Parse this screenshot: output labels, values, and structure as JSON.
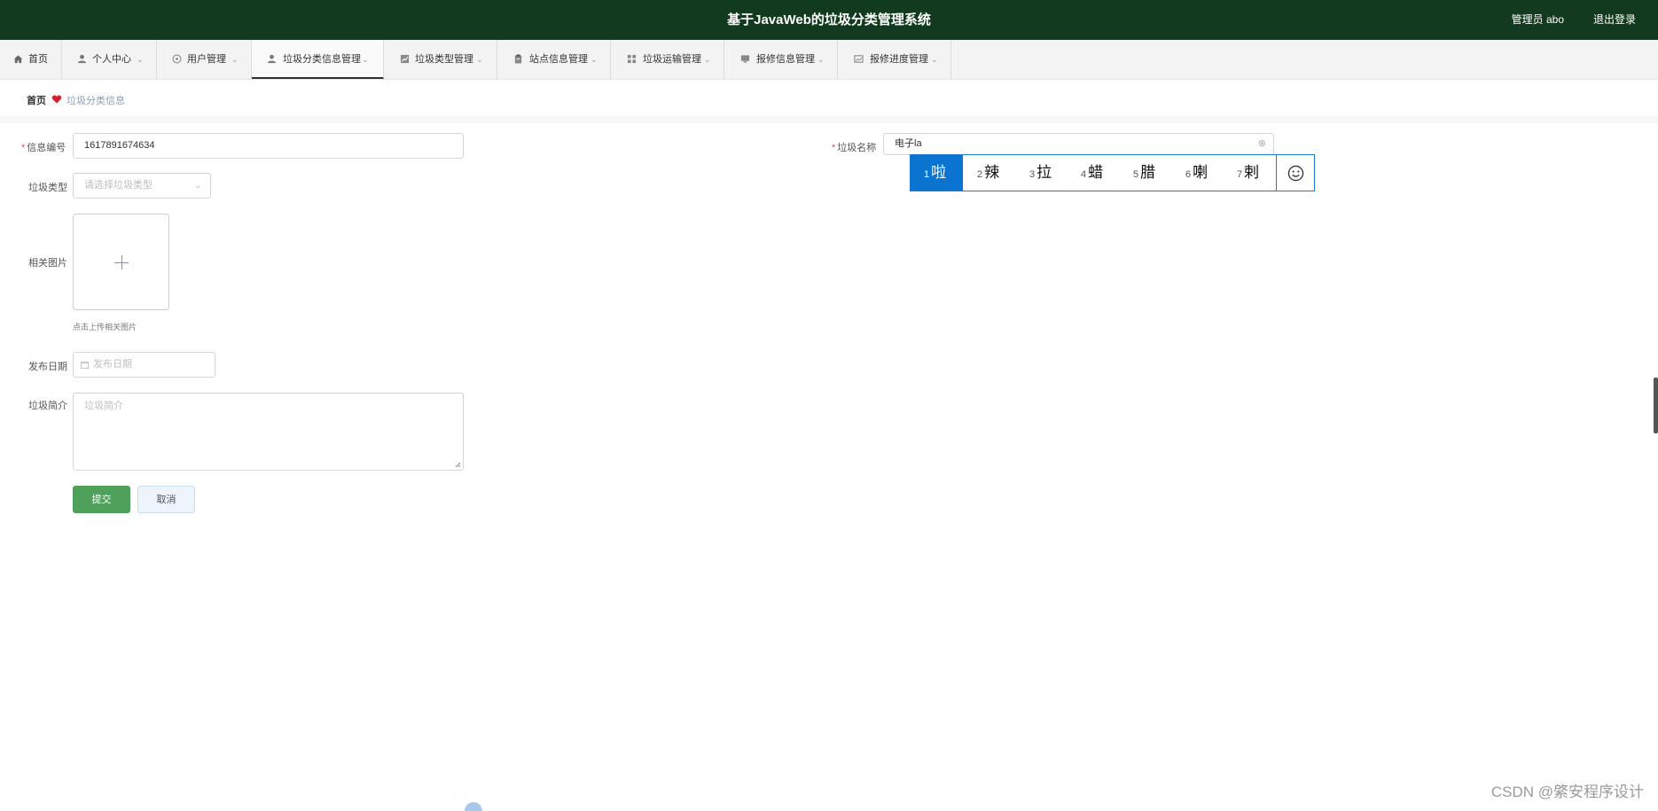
{
  "header": {
    "title": "基于JavaWeb的垃圾分类管理系统",
    "user_label": "管理员 abo",
    "logout_label": "退出登录"
  },
  "nav": {
    "items": [
      {
        "label": "首页",
        "icon": "home-icon"
      },
      {
        "label": "个人中心",
        "icon": "user-icon"
      },
      {
        "label": "用户管理",
        "icon": "users-icon"
      },
      {
        "label": "垃圾分类信息管理",
        "icon": "user-icon",
        "active": true
      },
      {
        "label": "垃圾类型管理",
        "icon": "chart-icon"
      },
      {
        "label": "站点信息管理",
        "icon": "clipboard-icon"
      },
      {
        "label": "垃圾运输管理",
        "icon": "grid-icon"
      },
      {
        "label": "报修信息管理",
        "icon": "monitor-icon"
      },
      {
        "label": "报修进度管理",
        "icon": "image-icon"
      }
    ]
  },
  "breadcrumb": {
    "home": "首页",
    "current": "垃圾分类信息"
  },
  "form": {
    "info_no_label": "信息编号",
    "info_no_value": "1617891674634",
    "name_label": "垃圾名称",
    "name_value": "电子la",
    "type_label": "垃圾类型",
    "type_placeholder": "请选择垃圾类型",
    "image_label": "相关图片",
    "image_hint": "点击上传相关图片",
    "date_label": "发布日期",
    "date_placeholder": "发布日期",
    "intro_label": "垃圾简介",
    "intro_placeholder": "垃圾简介",
    "submit_label": "提交",
    "cancel_label": "取消"
  },
  "ime": {
    "candidates": [
      {
        "n": "1",
        "char": "啦",
        "selected": true
      },
      {
        "n": "2",
        "char": "辣"
      },
      {
        "n": "3",
        "char": "拉"
      },
      {
        "n": "4",
        "char": "蜡"
      },
      {
        "n": "5",
        "char": "腊"
      },
      {
        "n": "6",
        "char": "喇"
      },
      {
        "n": "7",
        "char": "剌"
      }
    ]
  },
  "watermark": "CSDN @綮安程序设计",
  "colors": {
    "header_bg": "#123a1e",
    "submit_green": "#4fa05b",
    "ime_blue": "#0b74d1"
  }
}
